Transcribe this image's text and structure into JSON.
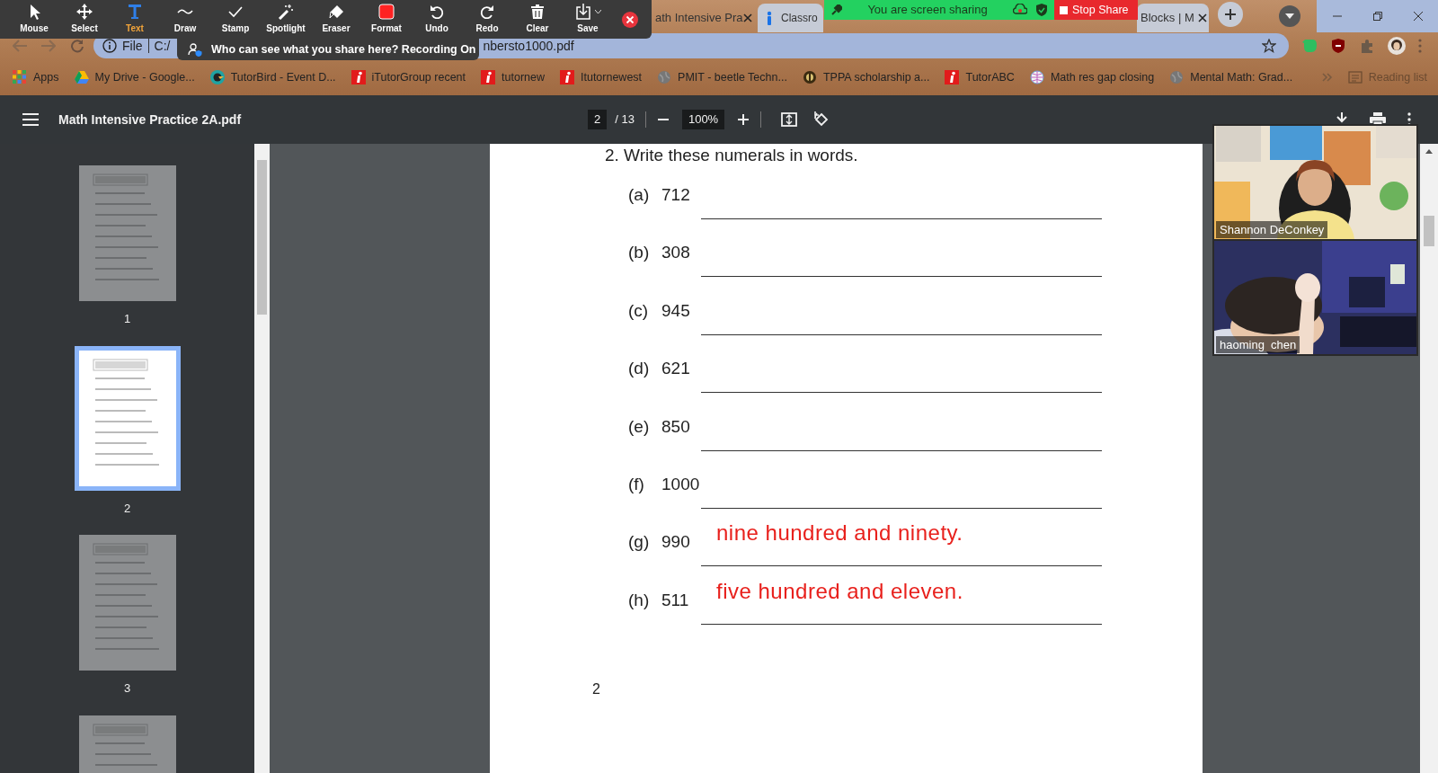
{
  "zoom_toolbar": {
    "tools": [
      {
        "label": "Mouse",
        "selected": false
      },
      {
        "label": "Select",
        "selected": false
      },
      {
        "label": "Text",
        "selected": true
      },
      {
        "label": "Draw",
        "selected": false
      },
      {
        "label": "Stamp",
        "selected": false
      },
      {
        "label": "Spotlight",
        "selected": false
      },
      {
        "label": "Eraser",
        "selected": false
      },
      {
        "label": "Format",
        "selected": false
      },
      {
        "label": "Undo",
        "selected": false
      },
      {
        "label": "Redo",
        "selected": false
      },
      {
        "label": "Clear",
        "selected": false
      },
      {
        "label": "Save",
        "selected": false
      }
    ]
  },
  "share_notice": "Who can see what you share here? Recording On",
  "sharing_banner": {
    "text": "You are screen sharing",
    "stop_button": "Stop Share"
  },
  "browser": {
    "tabs": [
      {
        "title": "ath Intensive Pra",
        "selected": true
      },
      {
        "title": "Classro",
        "selected": false
      },
      {
        "title": "Blocks | M",
        "selected": false
      }
    ],
    "address": {
      "scheme": "File",
      "path_start": "C:/",
      "path_end": "nbersto1000.pdf"
    },
    "bookmarks": [
      "Apps",
      "My Drive - Google...",
      "TutorBird - Event D...",
      "iTutorGroup recent",
      "tutornew",
      "Itutornewest",
      "PMIT - beetle Techn...",
      "TPPA scholarship a...",
      "TutorABC",
      "Math res gap closing",
      "Mental Math: Grad..."
    ],
    "reading_list": "Reading list"
  },
  "pdf_viewer": {
    "title": "Math Intensive Practice 2A.pdf",
    "page": "2",
    "page_count": "/ 13",
    "zoom": "100%",
    "thumbnails": [
      {
        "label": "1",
        "selected": false
      },
      {
        "label": "2",
        "selected": true
      },
      {
        "label": "3",
        "selected": false
      },
      {
        "selected": false
      }
    ],
    "document": {
      "question": "2.  Write these numerals in words.",
      "items": [
        {
          "label": "(a)",
          "numeral": "712"
        },
        {
          "label": "(b)",
          "numeral": "308"
        },
        {
          "label": "(c)",
          "numeral": "945"
        },
        {
          "label": "(d)",
          "numeral": "621"
        },
        {
          "label": "(e)",
          "numeral": "850"
        },
        {
          "label": "(f)",
          "numeral": "1000"
        },
        {
          "label": "(g)",
          "numeral": "990",
          "answer": "nine hundred and ninety."
        },
        {
          "label": "(h)",
          "numeral": "511",
          "answer": "five hundred and eleven."
        }
      ],
      "page_number": "2"
    }
  },
  "video_panels": [
    {
      "name": "Shannon DeConkey"
    },
    {
      "name": "haoming  chen"
    }
  ]
}
